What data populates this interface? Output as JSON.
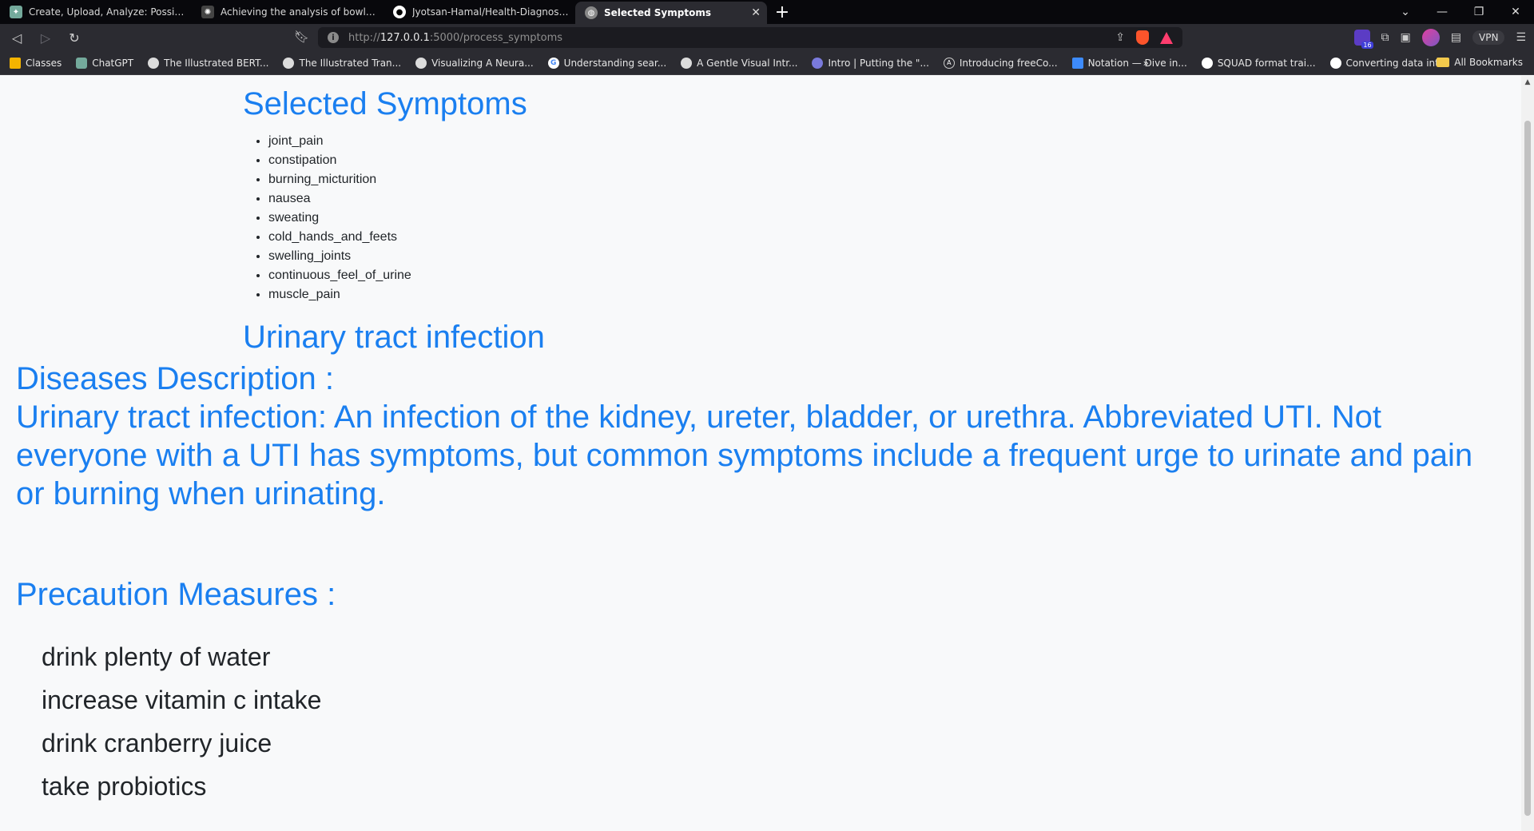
{
  "browser": {
    "tabs": [
      {
        "label": "Create, Upload, Analyze: Possible!",
        "icon": "chatgpt-icon",
        "active": false
      },
      {
        "label": "Achieving the analysis of bowling vide",
        "icon": "openai-icon",
        "active": false
      },
      {
        "label": "Jyotsan-Hamal/Health-Diagnose-Syste",
        "icon": "github-icon",
        "active": false
      },
      {
        "label": "Selected Symptoms",
        "icon": "globe-icon",
        "active": true
      }
    ],
    "new_tab": "+",
    "url_prefix": "http://",
    "url_host": "127.0.0.1",
    "url_rest": ":5000/process_symptoms",
    "vpn_label": "VPN",
    "extension_count": "16",
    "bookmarks": [
      {
        "label": "Classes",
        "icon": "classroom-icon"
      },
      {
        "label": "ChatGPT",
        "icon": "chatgpt-icon"
      },
      {
        "label": "The Illustrated BERT...",
        "icon": "globe-icon"
      },
      {
        "label": "The Illustrated Tran...",
        "icon": "globe-icon"
      },
      {
        "label": "Visualizing A Neura...",
        "icon": "globe-icon"
      },
      {
        "label": "Understanding sear...",
        "icon": "google-icon"
      },
      {
        "label": "A Gentle Visual Intr...",
        "icon": "globe-icon"
      },
      {
        "label": "Intro | Putting the \"...",
        "icon": "settings-icon"
      },
      {
        "label": "Introducing freeCo...",
        "icon": "freecodecamp-icon"
      },
      {
        "label": "Notation — Dive in...",
        "icon": "notation-icon"
      },
      {
        "label": "SQUAD format trai...",
        "icon": "github-icon"
      },
      {
        "label": "Converting data int...",
        "icon": "medium-icon"
      }
    ],
    "bookmarks_more": "»",
    "all_bookmarks": "All Bookmarks"
  },
  "page": {
    "heading": "Selected Symptoms",
    "symptoms": [
      "joint_pain",
      "constipation",
      "burning_micturition",
      "nausea",
      "sweating",
      "cold_hands_and_feets",
      "swelling_joints",
      "continuous_feel_of_urine",
      "muscle_pain"
    ],
    "predicted_disease": "Urinary tract infection",
    "description_title": "Diseases Description :",
    "description_text": "Urinary tract infection: An infection of the kidney, ureter, bladder, or urethra. Abbreviated UTI. Not everyone with a UTI has symptoms, but common symptoms include a frequent urge to urinate and pain or burning when urinating.",
    "precaution_title": "Precaution Measures :",
    "precautions": [
      "drink plenty of water",
      "increase vitamin c intake",
      "drink cranberry juice",
      "take probiotics"
    ]
  },
  "colors": {
    "accent": "#1a7ff0",
    "text": "#212529",
    "page_bg": "#f8f9fa",
    "chrome_bg": "#2b2b31"
  }
}
